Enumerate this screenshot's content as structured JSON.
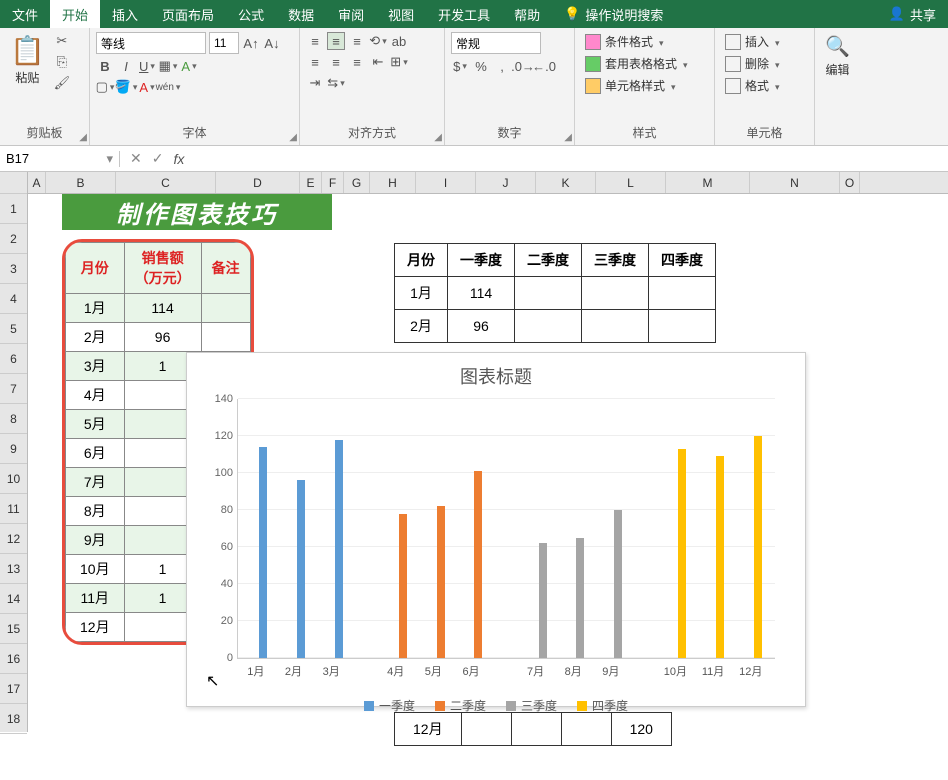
{
  "menu": {
    "file": "文件",
    "home": "开始",
    "insert": "插入",
    "layout": "页面布局",
    "formulas": "公式",
    "data": "数据",
    "review": "审阅",
    "view": "视图",
    "dev": "开发工具",
    "help": "帮助",
    "tell": "操作说明搜索",
    "share": "共享"
  },
  "ribbon": {
    "clipboard": "剪贴板",
    "paste": "粘贴",
    "font": "字体",
    "fontname": "等线",
    "fontsize": "11",
    "bold": "B",
    "italic": "I",
    "underline": "U",
    "wen": "wén",
    "align": "对齐方式",
    "number": "数字",
    "numfmt": "常规",
    "styles": "样式",
    "condfmt": "条件格式",
    "tblfmt": "套用表格格式",
    "cellfmt": "单元格样式",
    "cells": "单元格",
    "ins": "插入",
    "del": "删除",
    "fmt": "格式",
    "edit": "编辑"
  },
  "formula": {
    "cell": "B17"
  },
  "columns": [
    "A",
    "B",
    "C",
    "D",
    "E",
    "F",
    "G",
    "H",
    "I",
    "J",
    "K",
    "L",
    "M",
    "N",
    "O"
  ],
  "rows": [
    "1",
    "2",
    "3",
    "4",
    "5",
    "6",
    "7",
    "8",
    "9",
    "10",
    "11",
    "12",
    "13",
    "14",
    "15",
    "16",
    "17",
    "18"
  ],
  "banner": "制作图表技巧",
  "table1": {
    "headers": [
      "月份",
      "销售额\n（万元）",
      "备注"
    ],
    "rows": [
      [
        "1月",
        "114",
        ""
      ],
      [
        "2月",
        "96",
        ""
      ],
      [
        "3月",
        "1",
        ""
      ],
      [
        "4月",
        "",
        ""
      ],
      [
        "5月",
        "",
        ""
      ],
      [
        "6月",
        "",
        ""
      ],
      [
        "7月",
        "",
        ""
      ],
      [
        "8月",
        "",
        ""
      ],
      [
        "9月",
        "",
        ""
      ],
      [
        "10月",
        "1",
        ""
      ],
      [
        "11月",
        "1",
        ""
      ],
      [
        "12月",
        "",
        ""
      ]
    ]
  },
  "table2": {
    "headers": [
      "月份",
      "一季度",
      "二季度",
      "三季度",
      "四季度"
    ],
    "rows": [
      [
        "1月",
        "114",
        "",
        "",
        ""
      ],
      [
        "2月",
        "96",
        "",
        "",
        ""
      ]
    ]
  },
  "table3": {
    "rows": [
      [
        "12月",
        "",
        "",
        "",
        "120"
      ]
    ]
  },
  "chart": {
    "title": "图表标题",
    "legend": [
      "一季度",
      "二季度",
      "三季度",
      "四季度"
    ],
    "colors": [
      "#5b9bd5",
      "#ed7d31",
      "#a5a5a5",
      "#ffc000"
    ]
  },
  "chart_data": {
    "type": "bar",
    "title": "图表标题",
    "xlabel": "",
    "ylabel": "",
    "ylim": [
      0,
      140
    ],
    "yticks": [
      0,
      20,
      40,
      60,
      80,
      100,
      120,
      140
    ],
    "categories": [
      "1月",
      "2月",
      "3月",
      "4月",
      "5月",
      "6月",
      "7月",
      "8月",
      "9月",
      "10月",
      "11月",
      "12月"
    ],
    "series": [
      {
        "name": "一季度",
        "color": "#5b9bd5",
        "values": [
          114,
          96,
          118,
          null,
          null,
          null,
          null,
          null,
          null,
          null,
          null,
          null
        ]
      },
      {
        "name": "二季度",
        "color": "#ed7d31",
        "values": [
          null,
          null,
          null,
          78,
          82,
          101,
          null,
          null,
          null,
          null,
          null,
          null
        ]
      },
      {
        "name": "三季度",
        "color": "#a5a5a5",
        "values": [
          null,
          null,
          null,
          null,
          null,
          null,
          62,
          65,
          80,
          null,
          null,
          null
        ]
      },
      {
        "name": "四季度",
        "color": "#ffc000",
        "values": [
          null,
          null,
          null,
          null,
          null,
          null,
          null,
          null,
          null,
          113,
          109,
          120
        ]
      }
    ]
  }
}
